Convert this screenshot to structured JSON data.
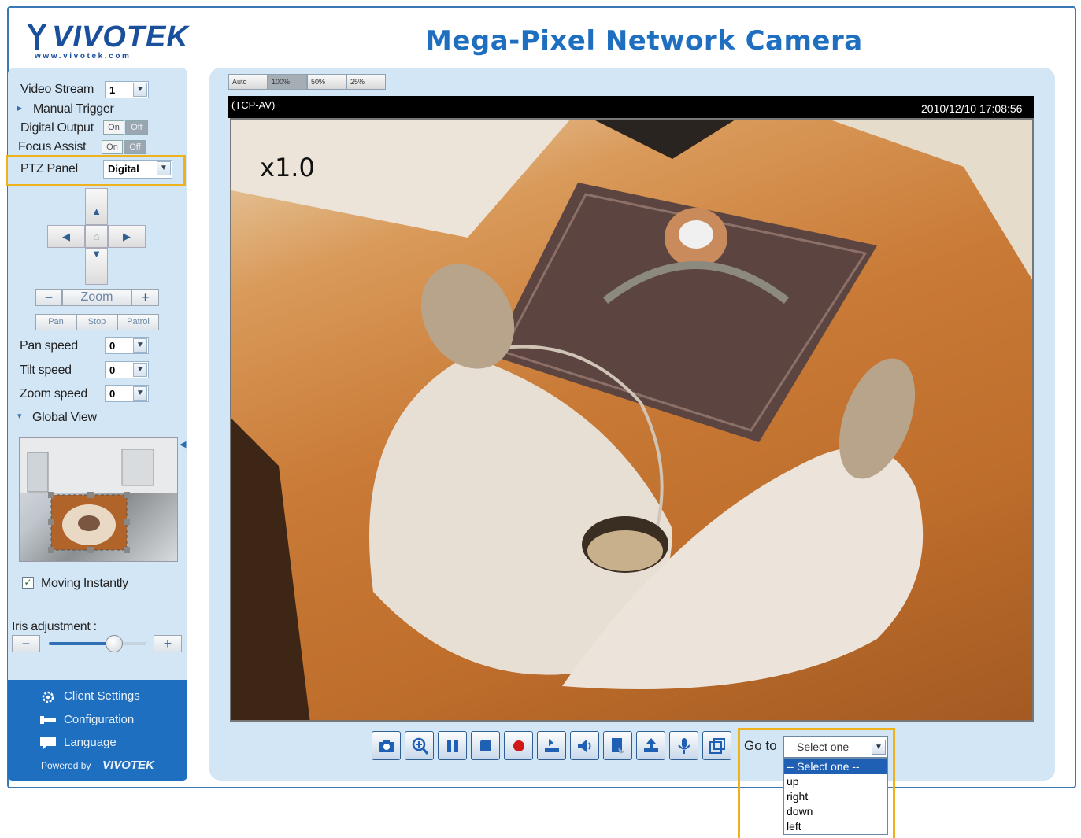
{
  "header": {
    "logo_text": "VIVOTEK",
    "logo_url": "www.vivotek.com",
    "title": "Mega-Pixel Network Camera"
  },
  "sidebar": {
    "video_stream": {
      "label": "Video Stream",
      "value": "1"
    },
    "manual_trigger": "Manual Trigger",
    "digital_output": {
      "label": "Digital Output",
      "on": "On",
      "off": "Off"
    },
    "focus_assist": {
      "label": "Focus Assist",
      "on": "On",
      "off": "Off"
    },
    "ptz_panel": {
      "label": "PTZ Panel",
      "value": "Digital"
    },
    "zoom_label": "Zoom",
    "zoom_minus": "−",
    "zoom_plus": "+",
    "pan_button": "Pan",
    "stop_button": "Stop",
    "patrol_button": "Patrol",
    "pan_speed": {
      "label": "Pan speed",
      "value": "0"
    },
    "tilt_speed": {
      "label": "Tilt speed",
      "value": "0"
    },
    "zoom_speed": {
      "label": "Zoom speed",
      "value": "0"
    },
    "global_view": "Global View",
    "moving_instantly": "Moving Instantly",
    "iris_adjustment": {
      "label": "Iris adjustment :",
      "minus": "−",
      "plus": "+",
      "level": 0.67
    },
    "nav": {
      "client_settings": "Client Settings",
      "configuration": "Configuration",
      "language": "Language",
      "powered_by": "Powered by",
      "powered_logo": "VIVOTEK"
    }
  },
  "viewer": {
    "size_buttons": [
      "Auto",
      "100%",
      "50%",
      "25%"
    ],
    "active_size": "100%",
    "mode": "(TCP-AV)",
    "timestamp": "2010/12/10  17:08:56",
    "zoom_factor": "x1.0"
  },
  "controls": {
    "icons": [
      "snapshot-icon",
      "digital-zoom-icon",
      "pause-icon",
      "stop-icon",
      "record-icon",
      "volume-in-icon",
      "speaker-icon",
      "talk-icon",
      "upload-icon",
      "microphone-icon",
      "fullscreen-icon"
    ]
  },
  "goto": {
    "label": "Go to",
    "selected": "Select one",
    "options": [
      "-- Select one --",
      "up",
      "right",
      "down",
      "left"
    ]
  },
  "colors": {
    "accent": "#1f6fc0",
    "panel": "#d3e6f6",
    "highlight": "#f0b21c"
  }
}
